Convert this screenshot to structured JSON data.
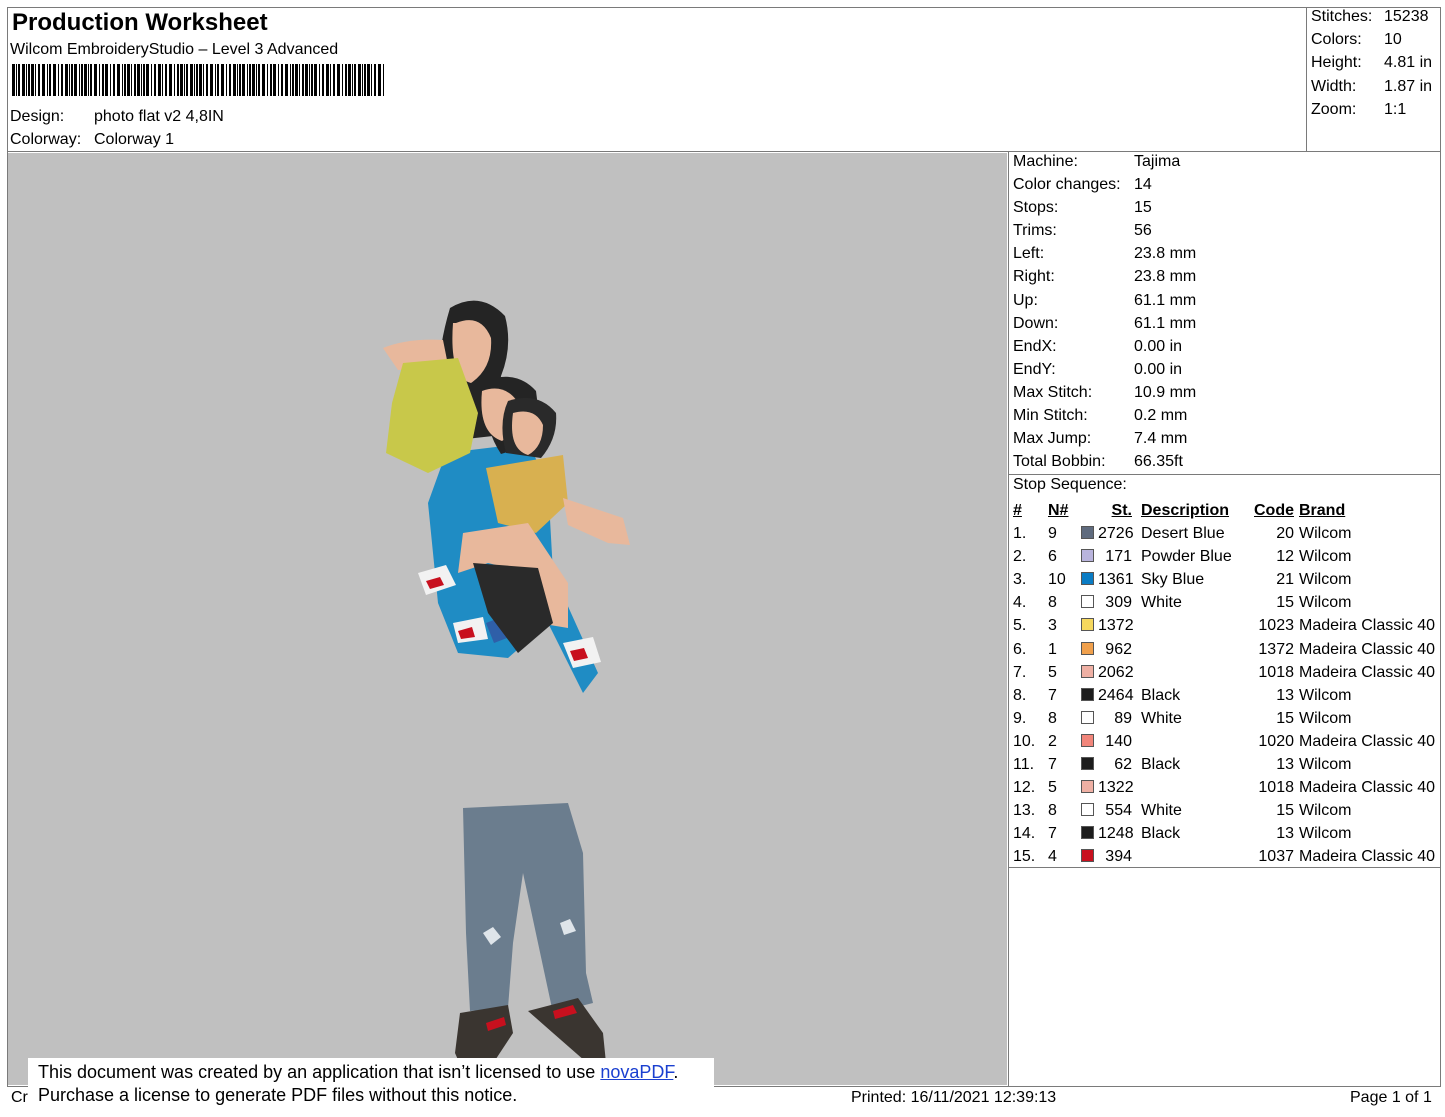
{
  "header": {
    "title": "Production Worksheet",
    "software": "Wilcom EmbroideryStudio – Level 3 Advanced",
    "design_label": "Design:",
    "design_value": "photo flat v2 4,8IN",
    "colorway_label": "Colorway:",
    "colorway_value": "Colorway 1"
  },
  "summary": [
    {
      "label": "Stitches:",
      "value": "15238"
    },
    {
      "label": "Colors:",
      "value": "10"
    },
    {
      "label": "Height:",
      "value": "4.81 in"
    },
    {
      "label": "Width:",
      "value": "1.87 in"
    },
    {
      "label": "Zoom:",
      "value": "1:1"
    }
  ],
  "machine_info": [
    {
      "label": "Machine:",
      "value": "Tajima"
    },
    {
      "label": "Color changes:",
      "value": "14"
    },
    {
      "label": "Stops:",
      "value": "15"
    },
    {
      "label": "Trims:",
      "value": "56"
    },
    {
      "label": "Left:",
      "value": "23.8 mm"
    },
    {
      "label": "Right:",
      "value": "23.8 mm"
    },
    {
      "label": "Up:",
      "value": "61.1 mm"
    },
    {
      "label": "Down:",
      "value": "61.1 mm"
    },
    {
      "label": "EndX:",
      "value": "0.00 in"
    },
    {
      "label": "EndY:",
      "value": "0.00 in"
    },
    {
      "label": "Max Stitch:",
      "value": "10.9 mm"
    },
    {
      "label": "Min Stitch:",
      "value": "0.2 mm"
    },
    {
      "label": "Max Jump:",
      "value": "7.4 mm"
    },
    {
      "label": "Total Bobbin:",
      "value": "66.35ft"
    },
    {
      "label": "Stop Sequence:",
      "value": ""
    }
  ],
  "stop_sequence": {
    "headers": {
      "idx": "#",
      "n": "N#",
      "st": "St.",
      "desc": "Description",
      "code": "Code",
      "brand": "Brand"
    },
    "rows": [
      {
        "idx": "1.",
        "n": "9",
        "color": "#5f6b7e",
        "st": "2726",
        "desc": "Desert Blue",
        "code": "20",
        "brand": "Wilcom"
      },
      {
        "idx": "2.",
        "n": "6",
        "color": "#b9b4dd",
        "st": "171",
        "desc": "Powder Blue",
        "code": "12",
        "brand": "Wilcom"
      },
      {
        "idx": "3.",
        "n": "10",
        "color": "#0a7cc4",
        "st": "1361",
        "desc": "Sky Blue",
        "code": "21",
        "brand": "Wilcom"
      },
      {
        "idx": "4.",
        "n": "8",
        "color": "#ffffff",
        "st": "309",
        "desc": "White",
        "code": "15",
        "brand": "Wilcom"
      },
      {
        "idx": "5.",
        "n": "3",
        "color": "#f6d85e",
        "st": "1372",
        "desc": "",
        "code": "1023",
        "brand": "Madeira Classic 40"
      },
      {
        "idx": "6.",
        "n": "1",
        "color": "#f0a04c",
        "st": "962",
        "desc": "",
        "code": "1372",
        "brand": "Madeira Classic 40"
      },
      {
        "idx": "7.",
        "n": "5",
        "color": "#efb0a4",
        "st": "2062",
        "desc": "",
        "code": "1018",
        "brand": "Madeira Classic 40"
      },
      {
        "idx": "8.",
        "n": "7",
        "color": "#1c1c1c",
        "st": "2464",
        "desc": "Black",
        "code": "13",
        "brand": "Wilcom"
      },
      {
        "idx": "9.",
        "n": "8",
        "color": "#ffffff",
        "st": "89",
        "desc": "White",
        "code": "15",
        "brand": "Wilcom"
      },
      {
        "idx": "10.",
        "n": "2",
        "color": "#f1857a",
        "st": "140",
        "desc": "",
        "code": "1020",
        "brand": "Madeira Classic 40"
      },
      {
        "idx": "11.",
        "n": "7",
        "color": "#1c1c1c",
        "st": "62",
        "desc": "Black",
        "code": "13",
        "brand": "Wilcom"
      },
      {
        "idx": "12.",
        "n": "5",
        "color": "#efb0a4",
        "st": "1322",
        "desc": "",
        "code": "1018",
        "brand": "Madeira Classic 40"
      },
      {
        "idx": "13.",
        "n": "8",
        "color": "#ffffff",
        "st": "554",
        "desc": "White",
        "code": "15",
        "brand": "Wilcom"
      },
      {
        "idx": "14.",
        "n": "7",
        "color": "#1c1c1c",
        "st": "1248",
        "desc": "Black",
        "code": "13",
        "brand": "Wilcom"
      },
      {
        "idx": "15.",
        "n": "4",
        "color": "#c8101e",
        "st": "394",
        "desc": "",
        "code": "1037",
        "brand": "Madeira Classic 40"
      }
    ]
  },
  "notice": {
    "line1_prefix": "This document was created by an application that isn’t licensed to use ",
    "link": "novaPDF",
    "line1_suffix": ".",
    "line2": "Purchase a license to generate PDF files without this notice."
  },
  "footer": {
    "cr": "Cr",
    "printed": "Printed: 16/11/2021 12:39:13",
    "page": "Page 1 of 1"
  }
}
